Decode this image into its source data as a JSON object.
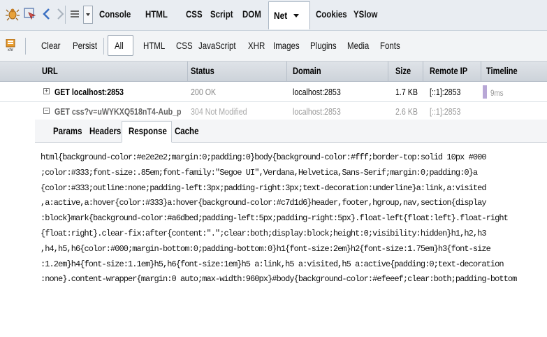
{
  "toolbar": {
    "tabs": [
      "Console",
      "HTML",
      "CSS",
      "Script",
      "DOM",
      "Net",
      "Cookies",
      "YSlow"
    ],
    "active_tab": "Net",
    "icons": [
      "firebug-icon",
      "inspect-icon",
      "back-icon",
      "forward-icon",
      "menu-icon",
      "dropdown-icon"
    ]
  },
  "filterbar": {
    "items": [
      "Clear",
      "Persist",
      "All",
      "HTML",
      "CSS",
      "JavaScript",
      "XHR",
      "Images",
      "Plugins",
      "Media",
      "Fonts"
    ],
    "selected": "All",
    "xhr_icon_label": "xhr"
  },
  "columns": [
    "URL",
    "Status",
    "Domain",
    "Size",
    "Remote IP",
    "Timeline"
  ],
  "requests": [
    {
      "url": "GET localhost:2853",
      "status": "200 OK",
      "domain": "localhost:2853",
      "size": "1.7 KB",
      "ip": "[::1]:2853",
      "timeline": "9ms",
      "expanded": false
    },
    {
      "url": "GET css?v=uWYKXQ518nT4-Aub_p",
      "status": "304 Not Modified",
      "domain": "localhost:2853",
      "size": "2.6 KB",
      "ip": "[::1]:2853",
      "timeline": "",
      "expanded": true
    }
  ],
  "detail": {
    "tabs": [
      "Params",
      "Headers",
      "Response",
      "Cache"
    ],
    "active_tab": "Response",
    "response_lines": [
      "html{background-color:#e2e2e2;margin:0;padding:0}body{background-color:#fff;border-top:solid 10px #000",
      ";color:#333;font-size:.85em;font-family:\"Segoe UI\",Verdana,Helvetica,Sans-Serif;margin:0;padding:0}a",
      "{color:#333;outline:none;padding-left:3px;padding-right:3px;text-decoration:underline}a:link,a:visited",
      ",a:active,a:hover{color:#333}a:hover{background-color:#c7d1d6}header,footer,hgroup,nav,section{display",
      ":block}mark{background-color:#a6dbed;padding-left:5px;padding-right:5px}.float-left{float:left}.float-right",
      "{float:right}.clear-fix:after{content:\".\";clear:both;display:block;height:0;visibility:hidden}h1,h2,h3",
      ",h4,h5,h6{color:#000;margin-bottom:0;padding-bottom:0}h1{font-size:2em}h2{font-size:1.75em}h3{font-size",
      ":1.2em}h4{font-size:1.1em}h5,h6{font-size:1em}h5 a:link,h5 a:visited,h5 a:active{padding:0;text-decoration",
      ":none}.content-wrapper{margin:0 auto;max-width:960px}#body{background-color:#efeeef;clear:both;padding-bottom"
    ]
  },
  "colors": {
    "toolbar_bg": "#e9edf2",
    "header_bg": "#cdd3da",
    "timeline_bar": "#b8a7d6",
    "muted_text": "#888888"
  }
}
